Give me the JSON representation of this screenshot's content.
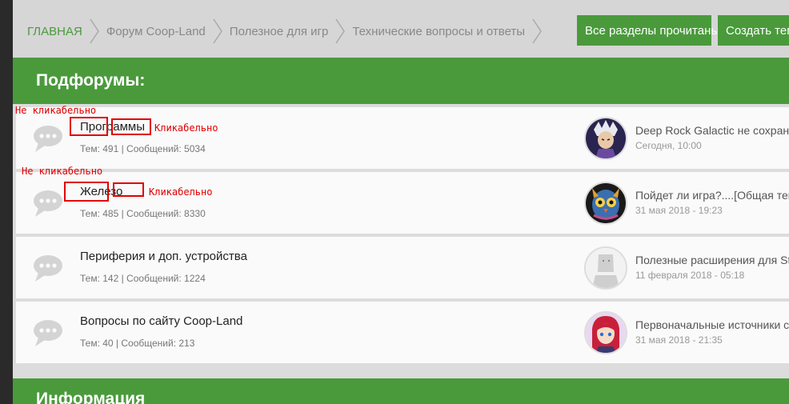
{
  "breadcrumb": {
    "items": [
      "ГЛАВНАЯ",
      "Форум Coop-Land",
      "Полезное для игр",
      "Технические вопросы и ответы"
    ]
  },
  "buttons": {
    "mark_read": "Все разделы прочитаны",
    "create_topic": "Создать тему"
  },
  "sections": {
    "subforums": "Подфорумы:",
    "info": "Информация"
  },
  "forums": [
    {
      "title": "Программы",
      "meta": "Тем: 491 | Сообщений: 5034",
      "last_title": "Deep Rock Galactic не сохраня...",
      "last_date": "Сегодня, 10:00"
    },
    {
      "title": "Железо",
      "meta": "Тем: 485 | Сообщений: 8330",
      "last_title": "Пойдет ли игра?....[Общая тем...",
      "last_date": "31 мая 2018 - 19:23"
    },
    {
      "title": "Периферия и доп. устройства",
      "meta": "Тем: 142 | Сообщений: 1224",
      "last_title": "Полезные расширения для St...",
      "last_date": "11 февраля 2018 - 05:18"
    },
    {
      "title": "Вопросы по сайту Coop-Land",
      "meta": "Тем: 40 | Сообщений: 213",
      "last_title": "Первоначальные источники с...",
      "last_date": "31 мая 2018 - 21:35"
    }
  ],
  "annotations": {
    "not_clickable_1": "Не кликабельно",
    "clickable_1": "Кликабельно",
    "not_clickable_2": "Не кликабельно",
    "clickable_2": "Кликабельно"
  },
  "colors": {
    "accent": "#4a9a3c",
    "annotation": "#e00000"
  }
}
